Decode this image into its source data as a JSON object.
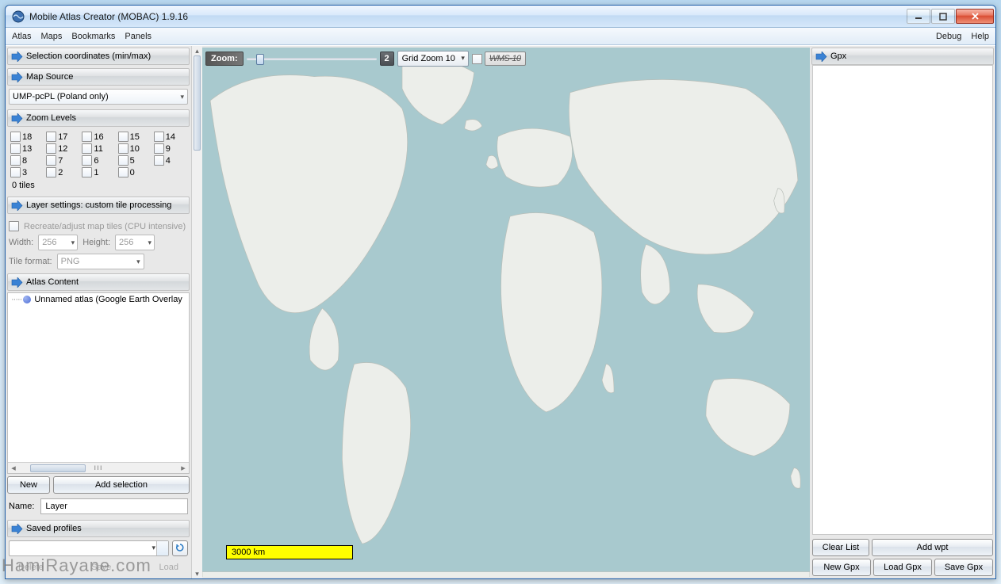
{
  "window": {
    "title": "Mobile Atlas Creator (MOBAC) 1.9.16"
  },
  "menubar": {
    "left": [
      "Atlas",
      "Maps",
      "Bookmarks",
      "Panels"
    ],
    "right": [
      "Debug",
      "Help"
    ]
  },
  "sidebar": {
    "selection_coords": {
      "title": "Selection coordinates (min/max)"
    },
    "map_source": {
      "title": "Map Source",
      "value": "UMP-pcPL (Poland only)"
    },
    "zoom_levels": {
      "title": "Zoom Levels",
      "levels": [
        "18",
        "17",
        "16",
        "15",
        "14",
        "13",
        "12",
        "11",
        "10",
        "9",
        "8",
        "7",
        "6",
        "5",
        "4",
        "3",
        "2",
        "1",
        "0"
      ],
      "tiles_label": "0 tiles"
    },
    "layer_settings": {
      "title": "Layer settings: custom tile processing",
      "recreate_label": "Recreate/adjust map tiles (CPU intensive)",
      "width_label": "Width:",
      "width_value": "256",
      "height_label": "Height:",
      "height_value": "256",
      "format_label": "Tile format:",
      "format_value": "PNG"
    },
    "atlas_content": {
      "title": "Atlas Content",
      "root_node": "Unnamed atlas (Google Earth Overlay",
      "new_btn": "New",
      "add_selection_btn": "Add selection",
      "name_label": "Name:",
      "name_value": "Layer"
    },
    "saved_profiles": {
      "title": "Saved profiles",
      "delete_btn": "Delete",
      "save_btn": "Save",
      "load_btn": "Load"
    }
  },
  "map_toolbar": {
    "zoom_label": "Zoom:",
    "zoom_value": "2",
    "grid_value": "Grid Zoom 10",
    "wms_label": "WMS-10"
  },
  "scale_bar": "3000 km",
  "right_panel": {
    "title": "Gpx",
    "clear_list": "Clear List",
    "add_wpt": "Add wpt",
    "new_gpx": "New Gpx",
    "load_gpx": "Load Gpx",
    "save_gpx": "Save Gpx"
  },
  "watermark": "HamiRayane.com"
}
